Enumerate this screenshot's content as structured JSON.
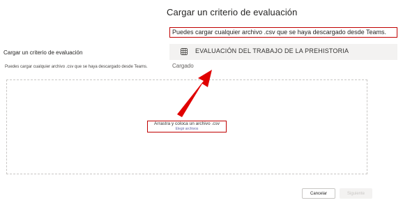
{
  "dialog": {
    "title": "Cargar un criterio de evaluación",
    "callout": "Puedes cargar cualquier archivo .csv que se haya descargado desde Teams."
  },
  "page": {
    "heading": "Cargar un criterio de evaluación",
    "subtext": "Puedes cargar cualquier archivo .csv que se haya descargado desde Teams."
  },
  "rubric": {
    "icon": "grid-icon",
    "name": "EVALUACIÓN DEL TRABAJO DE LA PREHISTORIA",
    "status": "Cargado"
  },
  "dropzone": {
    "text": "Arrastra y coloca un archivo .csv",
    "link": "Elegir archivos"
  },
  "footer": {
    "cancel_label": "Cancelar",
    "next_label": "Siguiente"
  },
  "colors": {
    "annotation": "#c00000",
    "accent": "#6264a7"
  }
}
